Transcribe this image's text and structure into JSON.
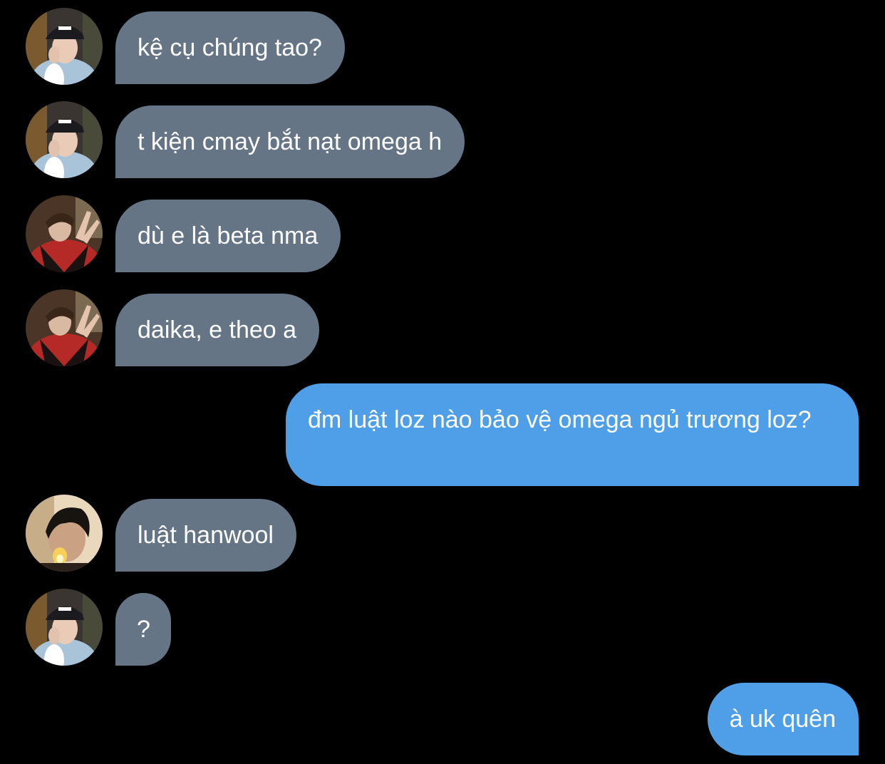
{
  "messages": [
    {
      "side": "in",
      "avatar": "avatar-cap",
      "text": "kệ cụ chúng tao?"
    },
    {
      "side": "in",
      "avatar": "avatar-cap",
      "text": "t kiện cmay bắt nạt omega h"
    },
    {
      "side": "in",
      "avatar": "avatar-red",
      "text": "dù e là beta nma"
    },
    {
      "side": "in",
      "avatar": "avatar-red",
      "text": "daika, e theo a"
    },
    {
      "side": "out",
      "text": "đm luật loz nào bảo vệ omega ngủ trương loz?"
    },
    {
      "side": "in",
      "avatar": "avatar-lighter",
      "text": "luật hanwool"
    },
    {
      "side": "in",
      "avatar": "avatar-cap",
      "text": "?"
    },
    {
      "side": "out",
      "text": "à uk quên"
    }
  ],
  "colors": {
    "background": "#000000",
    "incoming_bubble": "#657586",
    "outgoing_bubble": "#4e9ee8",
    "text": "#ffffff"
  }
}
